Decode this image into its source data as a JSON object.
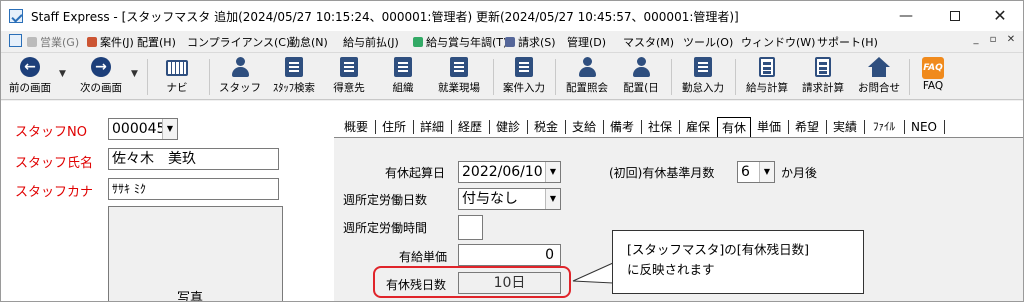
{
  "window": {
    "title": "Staff Express - [スタッフマスタ  追加(2024/05/27 10:15:24、000001:管理者)  更新(2024/05/27 10:45:57、000001:管理者)]",
    "minimize_glyph": "—",
    "maximize_glyph": "",
    "close_glyph": "✕"
  },
  "menu": {
    "items": [
      "営業(G)",
      "案件(J)",
      "配置(H)",
      "コンプライアンス(C)",
      "勤怠(N)",
      "給与前払(J)",
      "給与賞与年調(T)",
      "請求(S)",
      "管理(D)",
      "マスタ(M)",
      "ツール(O)",
      "ウィンドウ(W)",
      "サポート(H)"
    ],
    "mdi_controls": [
      "_",
      "▫",
      "✕"
    ]
  },
  "toolbar": {
    "prev": "前の画面",
    "next": "次の画面",
    "navi": "ナビ",
    "staff": "スタッフ",
    "staff_search": "ｽﾀｯﾌ検索",
    "customer": "得意先",
    "org": "組織",
    "worksite": "就業現場",
    "case_input": "案件入力",
    "placement_inquiry": "配置照会",
    "placement_day": "配置(日",
    "attendance_input": "勤怠入力",
    "payroll_calc": "給与計算",
    "billing_calc": "請求計算",
    "inquiry": "お問合せ",
    "faq": "FAQ",
    "faq_icon_text": "FAQ"
  },
  "staff": {
    "no_label": "スタッフNO",
    "no_value": "000045",
    "name_label": "スタッフ氏名",
    "name_value": "佐々木　美玖",
    "kana_label": "スタッフカナ",
    "kana_value": "ｻｻｷ ﾐｸ",
    "photo_label": "写真"
  },
  "tabs": [
    "概要",
    "住所",
    "詳細",
    "経歴",
    "健診",
    "税金",
    "支給",
    "備考",
    "社保",
    "雇保",
    "有休",
    "単価",
    "希望",
    "実績",
    "ﾌｧｲﾙ",
    "NEO"
  ],
  "active_tab": "有休",
  "leave": {
    "start_date_label": "有休起算日",
    "start_date_value": "2022/06/10",
    "base_months_label": "(初回)有休基準月数",
    "base_months_value": "6",
    "base_months_unit": "か月後",
    "weekly_days_label": "週所定労働日数",
    "weekly_days_value": "付与なし",
    "weekly_hours_label": "週所定労働時間",
    "weekly_hours_value": "",
    "paid_unit_price_label": "有給単価",
    "paid_unit_price_value": "0",
    "remaining_label": "有休残日数",
    "remaining_value": "10日"
  },
  "callout": {
    "line1": "[スタッフマスタ]の[有休残日数]",
    "line2": "に反映されます"
  },
  "colors": {
    "required_label": "#e00000",
    "highlight": "#e0242a",
    "icon_navy": "#1d3f7a",
    "faq_orange": "#f08a1c"
  }
}
